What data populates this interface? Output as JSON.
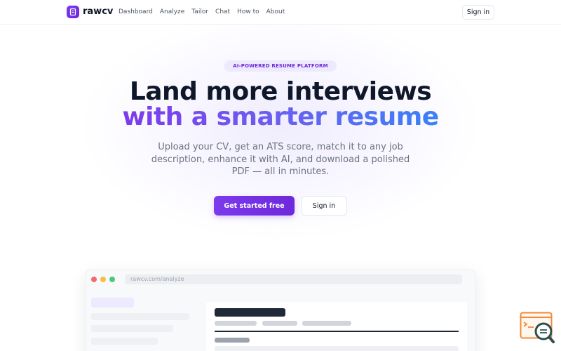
{
  "brand": {
    "name": "rawcv"
  },
  "nav": {
    "links": [
      "Dashboard",
      "Analyze",
      "Tailor",
      "Chat",
      "How to",
      "About"
    ],
    "signin_label": "Sign in"
  },
  "hero": {
    "badge": "AI-POWERED RESUME PLATFORM",
    "headline_line1": "Land more interviews",
    "headline_line2": "with a smarter resume",
    "subtitle": "Upload your CV, get an ATS score, match it to any job description, enhance it with AI, and download a polished PDF — all in minutes.",
    "primary_cta": "Get started free",
    "secondary_cta": "Sign in"
  },
  "preview": {
    "url": "rawcv.com/analyze"
  },
  "icons": {
    "logo": "document-icon",
    "floating": "search-document-icon",
    "window_controls": [
      "close-dot",
      "minimize-dot",
      "maximize-dot"
    ]
  },
  "colors": {
    "accent": "#7c3aed",
    "gradient_end": "#3b82f6",
    "badge_bg": "#ede9fe"
  }
}
